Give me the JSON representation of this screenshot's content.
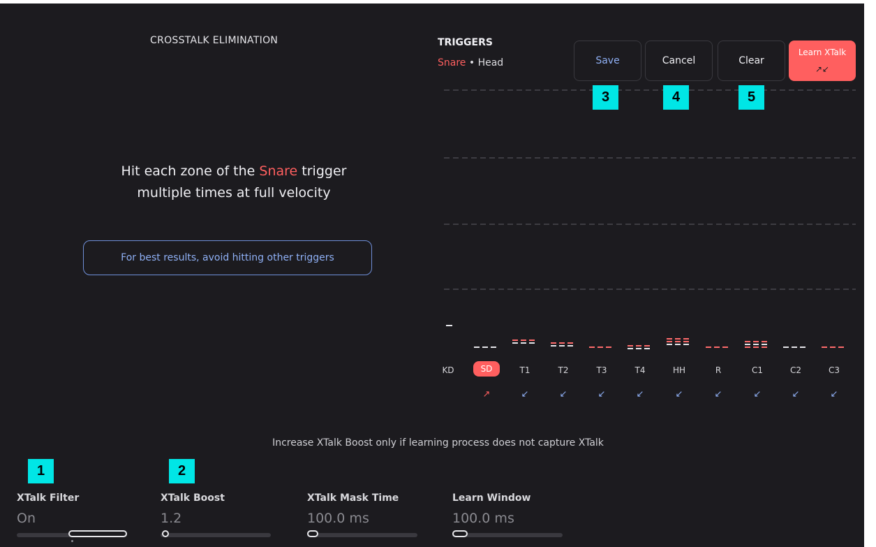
{
  "section_title": "CROSSTALK ELIMINATION",
  "instruction": {
    "line1_pre": "Hit each zone of the",
    "line1_trigger": "Snare",
    "line1_post": "trigger",
    "line2": "multiple times at full velocity"
  },
  "hint": "For best results, avoid hitting other triggers",
  "triggers": {
    "title": "TRIGGERS",
    "selected": "Snare",
    "separator": "•",
    "zone": "Head"
  },
  "buttons": {
    "save": "Save",
    "cancel": "Cancel",
    "clear": "Clear",
    "learn": "Learn XTalk",
    "learn_icon": "↗↙"
  },
  "badges": [
    "1",
    "2",
    "3",
    "4",
    "5"
  ],
  "columns": [
    {
      "label": "KD",
      "arrow": ""
    },
    {
      "label": "SD",
      "arrow": "↗"
    },
    {
      "label": "T1",
      "arrow": "↙"
    },
    {
      "label": "T2",
      "arrow": "↙"
    },
    {
      "label": "T3",
      "arrow": "↙"
    },
    {
      "label": "T4",
      "arrow": "↙"
    },
    {
      "label": "HH",
      "arrow": "↙"
    },
    {
      "label": "R",
      "arrow": "↙"
    },
    {
      "label": "C1",
      "arrow": "↙"
    },
    {
      "label": "C2",
      "arrow": "↙"
    },
    {
      "label": "C3",
      "arrow": "↙"
    }
  ],
  "footer_hint": "Increase XTalk Boost only if learning process does not capture XTalk",
  "params": [
    {
      "label": "XTalk Filter",
      "value": "On"
    },
    {
      "label": "XTalk Boost",
      "value": "1.2"
    },
    {
      "label": "XTalk Mask Time",
      "value": "100.0 ms"
    },
    {
      "label": "Learn Window",
      "value": "100.0 ms"
    }
  ],
  "colors": {
    "accent": "#ff5f5f",
    "blue": "#8fb0f5",
    "badge": "#00e6e6",
    "background": "#1c1b1f"
  }
}
